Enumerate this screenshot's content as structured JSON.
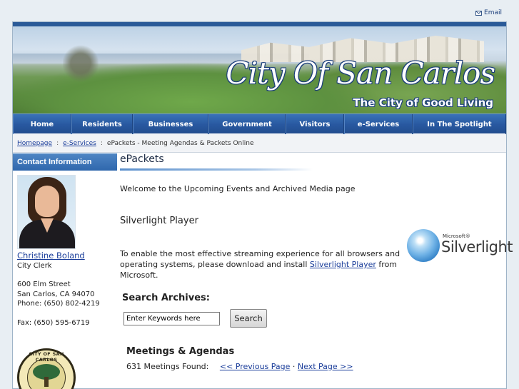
{
  "top": {
    "email_label": "Email"
  },
  "banner": {
    "title": "City Of San Carlos",
    "tagline": "The City of Good Living"
  },
  "nav": {
    "items": [
      "Home",
      "Residents",
      "Businesses",
      "Government",
      "Visitors",
      "e-Services",
      "In The Spotlight"
    ]
  },
  "breadcrumb": {
    "home": "Homepage",
    "sep1": ":",
    "eservices": "e-Services",
    "sep2": ":",
    "current": "ePackets - Meeting Agendas & Packets Online"
  },
  "sidebar": {
    "heading": "Contact Information",
    "name": "Christine Boland",
    "role": "City Clerk",
    "street": "600 Elm Street",
    "city": "San Carlos, CA 94070",
    "phone": "Phone: (650) 802-4219",
    "fax": "Fax: (650) 595-6719",
    "seal_text": "CITY OF SAN CARLOS"
  },
  "main": {
    "title": "ePackets",
    "welcome": "Welcome to the Upcoming Events and Archived Media page",
    "silverlight_heading": "Silverlight Player",
    "silverlight_text": "To enable the most effective streaming experience for all browsers and operating systems, please download and install",
    "silverlight_link": "Silverlight Player",
    "silverlight_tail": "from Microsoft.",
    "logo_ms": "Microsoft®",
    "logo_word": "Silverlight",
    "search_heading": "Search Archives:",
    "search_value": "Enter Keywords here",
    "search_button": "Search",
    "meetings_heading": "Meetings & Agendas",
    "meetings_count": "631 Meetings Found:",
    "prev": "<< Previous Page",
    "dot": "·",
    "next": "Next Page >>"
  },
  "colors": {
    "nav_blue": "#2858a0",
    "link_blue": "#1a3d9a"
  }
}
